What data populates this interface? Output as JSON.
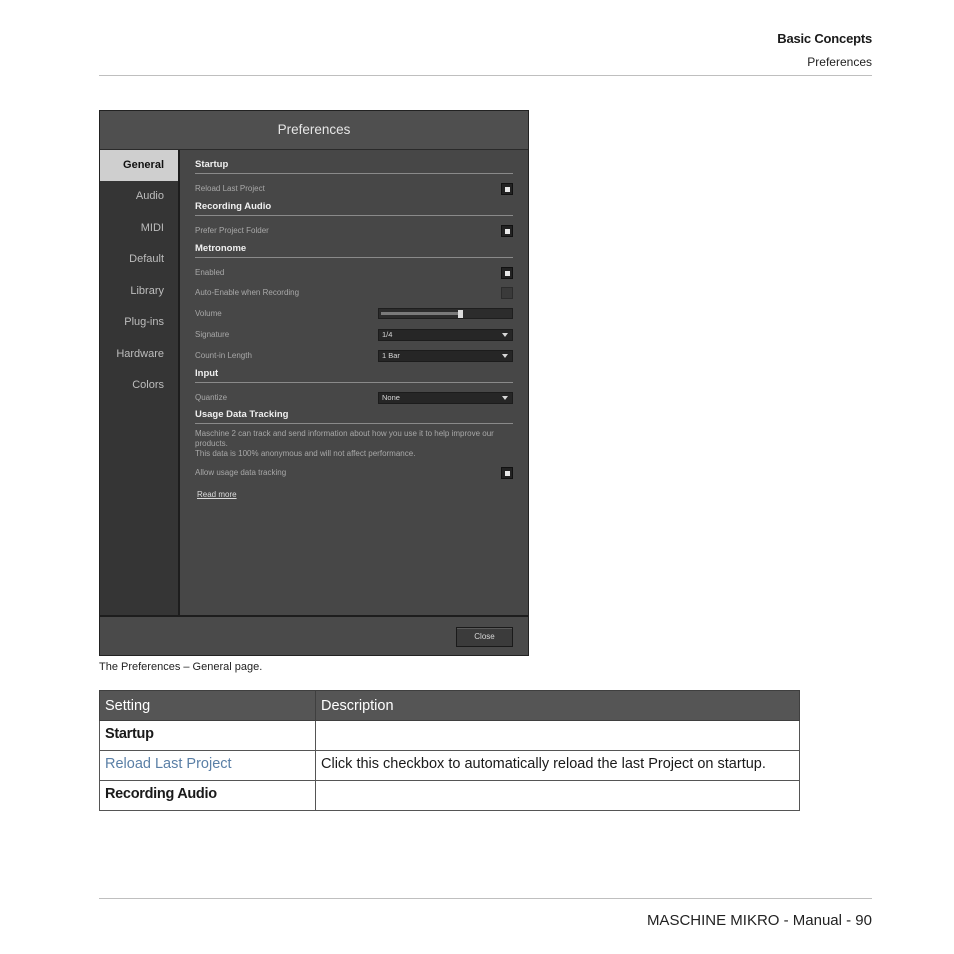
{
  "header": {
    "title": "Basic Concepts",
    "subtitle": "Preferences"
  },
  "window": {
    "title": "Preferences",
    "sidebar": [
      "General",
      "Audio",
      "MIDI",
      "Default",
      "Library",
      "Plug-ins",
      "Hardware",
      "Colors"
    ],
    "active_tab": "General",
    "sections": {
      "startup": "Startup",
      "recording_audio": "Recording Audio",
      "metronome": "Metronome",
      "input": "Input",
      "usage": "Usage Data Tracking"
    },
    "rows": {
      "reload_last_project": "Reload Last Project",
      "prefer_project_folder": "Prefer Project Folder",
      "enabled": "Enabled",
      "auto_enable": "Auto-Enable when Recording",
      "volume": "Volume",
      "volume_level": 0.6,
      "signature": "Signature",
      "signature_value": "1/4",
      "count_in": "Count-in Length",
      "count_in_value": "1 Bar",
      "quantize": "Quantize",
      "quantize_value": "None",
      "usage_desc_1": "Maschine 2 can track and send information about how you use it to help improve our products.",
      "usage_desc_2": "This data is 100% anonymous and will not affect performance.",
      "allow_usage": "Allow usage data tracking",
      "read_more": "Read more"
    },
    "close_label": "Close"
  },
  "caption": "The Preferences – General page.",
  "table": {
    "headers": [
      "Setting",
      "Description"
    ],
    "rows": [
      {
        "setting": "Startup",
        "description": ""
      },
      {
        "setting": "Reload Last Project",
        "description": "Click this checkbox to automatically reload the last Project on startup."
      },
      {
        "setting": "Recording Audio",
        "description": ""
      }
    ]
  },
  "footer": "MASCHINE MIKRO - Manual - 90"
}
